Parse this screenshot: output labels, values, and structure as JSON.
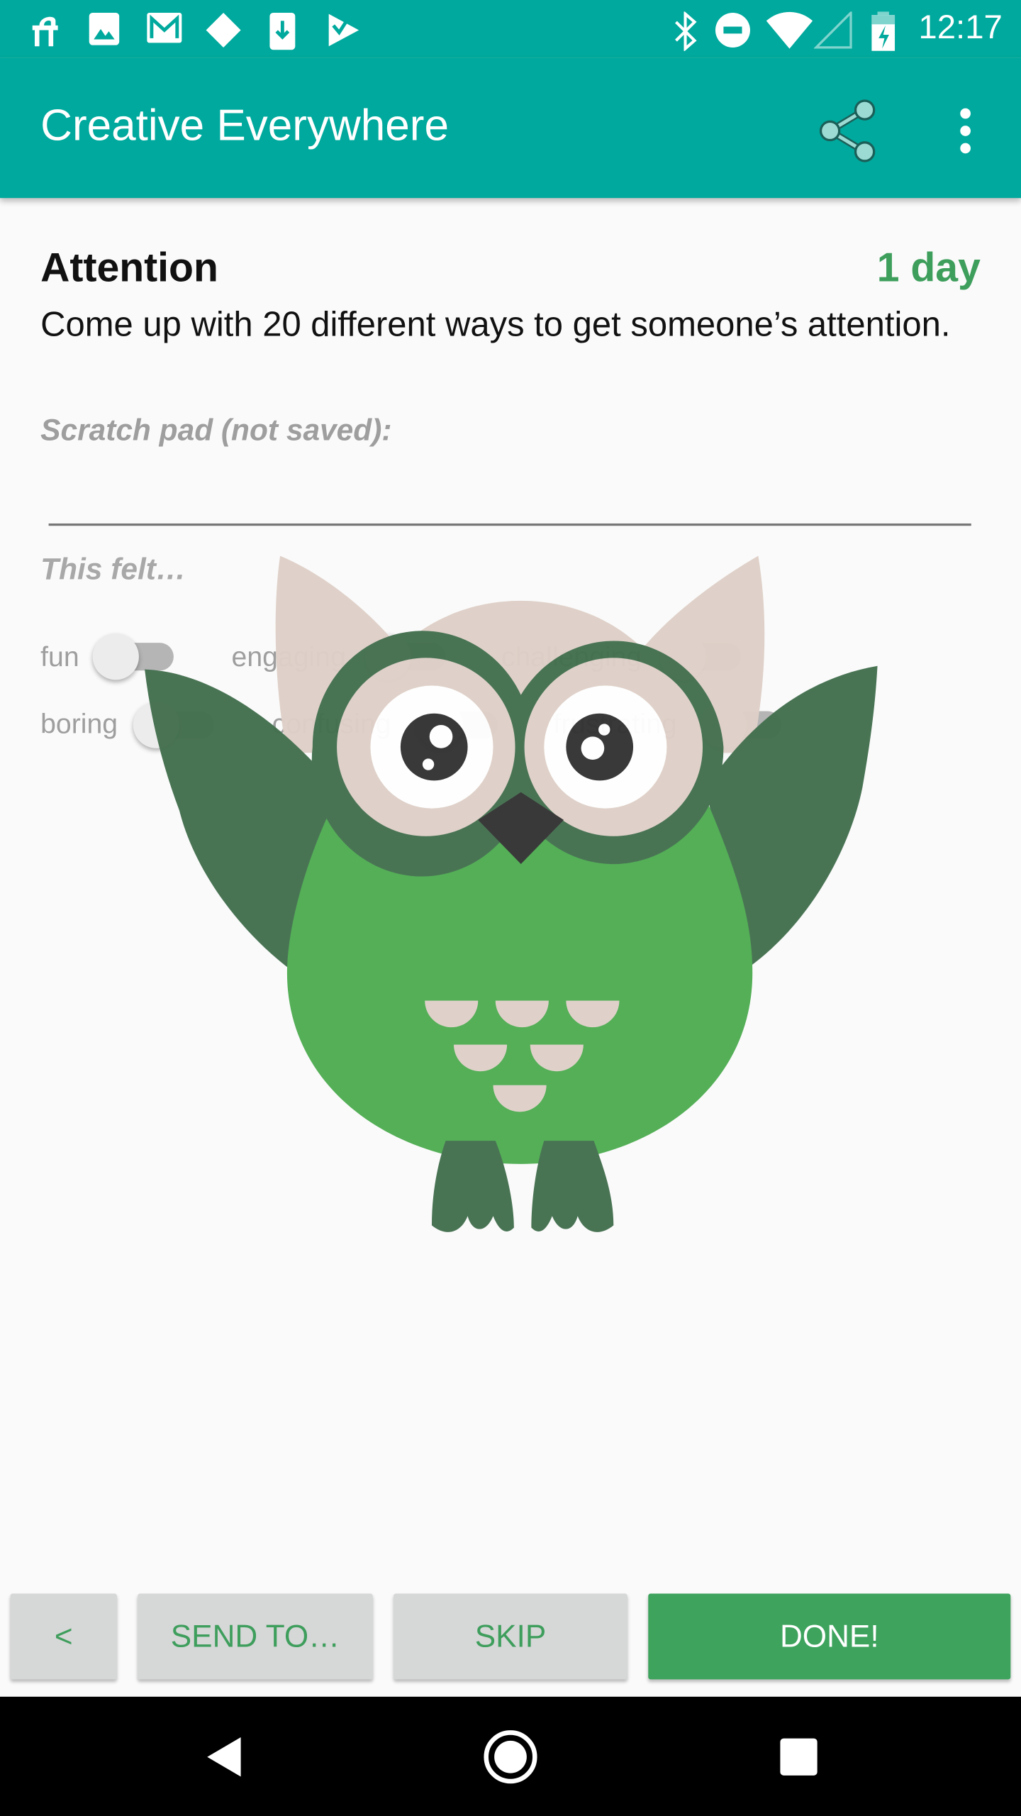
{
  "status_bar": {
    "time": "12:17",
    "icons": [
      "restaurant-icon",
      "image-icon",
      "gmail-icon",
      "diamond-icon",
      "download-icon",
      "check-icon",
      "bluetooth-icon",
      "do-not-disturb-icon",
      "wifi-icon",
      "signal-icon",
      "battery-charging-icon"
    ]
  },
  "app_bar": {
    "title": "Creative Everywhere",
    "share_icon": "share-icon",
    "menu_icon": "more-vert-icon",
    "color": "#00a99d"
  },
  "challenge": {
    "title": "Attention",
    "duration": "1 day",
    "description": "Come up with 20 different ways to get someone’s attention."
  },
  "scratch_pad": {
    "label": "Scratch pad (not saved):",
    "value": ""
  },
  "feelings": {
    "label": "This felt…",
    "toggles": [
      {
        "label": "fun",
        "on": false
      },
      {
        "label": "engaging",
        "on": false
      },
      {
        "label": "challenging",
        "on": false
      },
      {
        "label": "boring",
        "on": false
      },
      {
        "label": "confusing",
        "on": false
      },
      {
        "label": "frustrating",
        "on": false
      }
    ]
  },
  "buttons": {
    "back": "<",
    "send_to": "SEND TO…",
    "skip": "SKIP",
    "done": "DONE!"
  },
  "colors": {
    "accent_green": "#3e9e5c",
    "done_bg": "#3da35d",
    "owl_green": "#4fad52",
    "owl_dark_green": "#44704f",
    "owl_beige": "#dfd0c8"
  }
}
